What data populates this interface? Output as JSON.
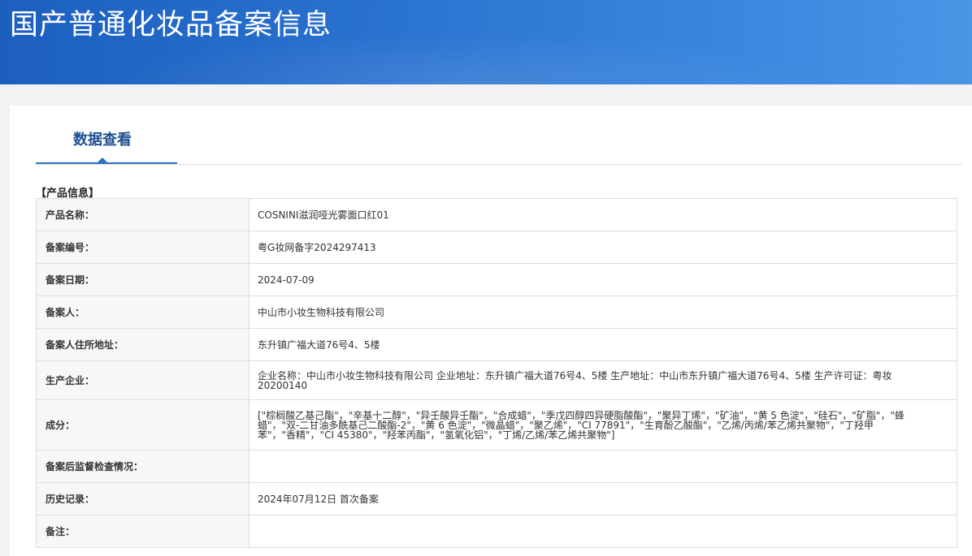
{
  "banner": {
    "title": "国产普通化妆品备案信息"
  },
  "tabs": [
    {
      "label": "数据查看",
      "active": true
    }
  ],
  "section": {
    "title": "【产品信息】"
  },
  "rows": [
    {
      "label": "产品名称：",
      "value": "COSNINI滋润哑光雾面口红01"
    },
    {
      "label": "备案编号：",
      "value": "粤G妆网备字2024297413"
    },
    {
      "label": "备案日期：",
      "value": "2024-07-09"
    },
    {
      "label": "备案人：",
      "value": "中山市小妆生物科技有限公司"
    },
    {
      "label": "备案人住所地址：",
      "value": "东升镇广福大道76号4、5楼"
    },
    {
      "label": "生产企业：",
      "value": "企业名称：中山市小妆生物科技有限公司 企业地址：东升镇广福大道76号4、5楼 生产地址：中山市东升镇广福大道76号4、5楼 生产许可证：粤妆20200140"
    },
    {
      "label": "成分：",
      "value": "[\"棕榈酸乙基己酯\"，\"辛基十二醇\"，\"异壬酸异壬酯\"，\"合成蜡\"，\"季戊四醇四异硬脂酸酯\"，\"聚异丁烯\"，\"矿油\"，\"黄 5 色淀\"，\"硅石\"，\"矿脂\"，\"蜂蜡\"，\"双-二甘油多酰基己二酸酯-2\"，\"黄 6 色淀\"，\"微晶蜡\"，\"聚乙烯\"，\"CI 77891\"，\"生育酚乙酸酯\"，\"乙烯/丙烯/苯乙烯共聚物\"，\"丁羟甲苯\"，\"香精\"，\"CI 45380\"，\"羟苯丙酯\"，\"氢氧化铝\"，\"丁烯/乙烯/苯乙烯共聚物\"]"
    },
    {
      "label": "备案后监督检查情况：",
      "value": ""
    },
    {
      "label": "历史记录：",
      "value": "2024年07月12日 首次备案"
    },
    {
      "label": "备注：",
      "value": ""
    }
  ]
}
